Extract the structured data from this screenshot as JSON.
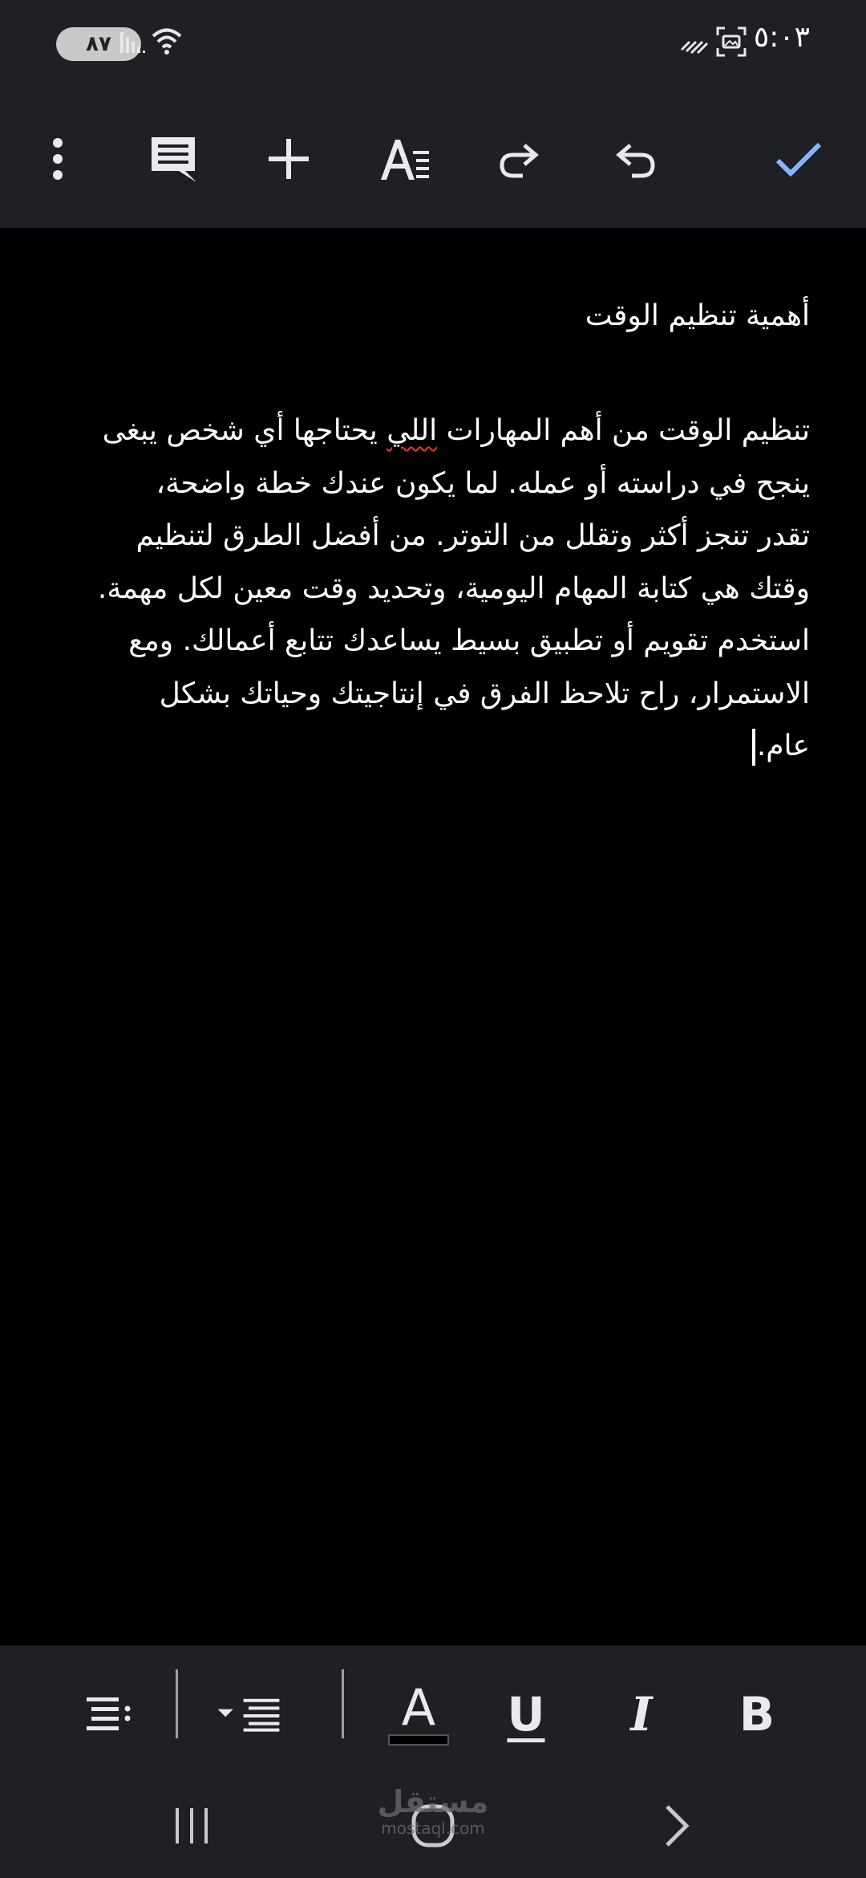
{
  "status_bar": {
    "battery_level": "٨٧",
    "clock": "٥:٠٣",
    "icons": [
      "battery-icon",
      "signal-icon",
      "wifi-icon",
      "screenshot-icon",
      "vibrate-icon"
    ]
  },
  "toolbar": {
    "icons": [
      "more-vert-icon",
      "comment-icon",
      "add-icon",
      "text-format-icon",
      "redo-icon",
      "undo-icon",
      "check-icon"
    ],
    "accent_color": "#8ab4f8"
  },
  "document": {
    "title": "أهمية تنظيم الوقت",
    "body_lines": [
      {
        "before": "تنظيم الوقت من أهم المهارات ",
        "misspelled": "اللي",
        "after": " يحتاجها أي شخص يبغى"
      },
      {
        "text": "ينجح في دراسته أو عمله. لما يكون عندك خطة واضحة،"
      },
      {
        "text": "تقدر تنجز أكثر وتقلل من التوتر. من أفضل الطرق لتنظيم"
      },
      {
        "text": "وقتك هي كتابة المهام اليومية، وتحديد وقت معين لكل مهمة."
      },
      {
        "text": "استخدم تقويم أو تطبيق بسيط يساعدك تتابع أعمالك. ومع"
      },
      {
        "text": "الاستمرار، راح تلاحظ الفرق في إنتاجيتك وحياتك بشكل"
      },
      {
        "text": "عام."
      }
    ]
  },
  "format_bar": {
    "text_color_label": "A",
    "underline_label": "U",
    "italic_label": "I",
    "bold_label": "B",
    "text_color_swatch": "#000000",
    "icons": [
      "list-icon",
      "align-dropdown-icon",
      "text-color-icon",
      "underline-icon",
      "italic-icon",
      "bold-icon"
    ]
  },
  "nav_bar": {
    "icons": [
      "recents-icon",
      "home-icon",
      "back-icon"
    ]
  },
  "watermark": {
    "arabic": "مستقل",
    "latin": "mostaql.com"
  }
}
